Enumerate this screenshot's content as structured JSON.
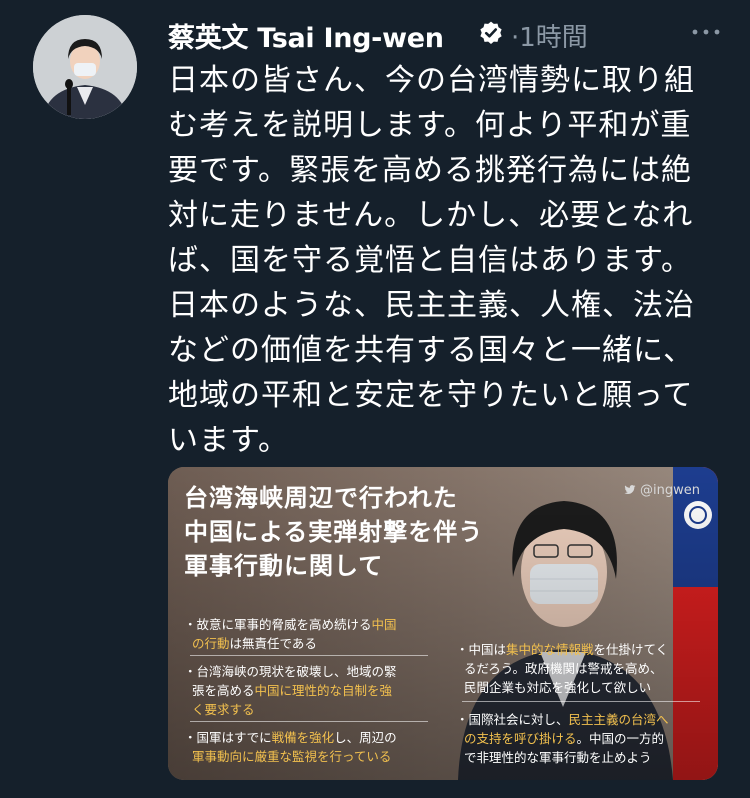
{
  "tweet": {
    "author_name": "蔡英文 Tsai Ing-wen",
    "time": "·1時間",
    "text_lines": [
      "日本の皆さん、今の台湾情勢に取り組",
      "む考えを説明します。何より平和が重",
      "要です。緊張を高める挑発行為には絶",
      "対に走りません。しかし、必要となれ",
      "ば、国を守る覚悟と自信はあります。",
      "日本のような、民主主義、人権、法治",
      "などの価値を共有する国々と一緒に、",
      "地域の平和と安定を守りたいと願って",
      "います。"
    ]
  },
  "icons": {
    "verified": "verified-badge-icon",
    "more": "more-dots-icon",
    "twitter": "twitter-bird-icon"
  },
  "card": {
    "handle": "@ingwen",
    "title_lines": [
      "台湾海峡周辺で行われた",
      "中国による実弾射撃を伴う",
      "軍事行動に関して"
    ],
    "left_bullets": [
      {
        "line1_pre": "・故意に軍事的脅威を高め続ける",
        "line1_hl": "中国",
        "line2_hl": "の行動",
        "line2_post": "は無責任である"
      },
      {
        "line1": "・台湾海峡の現状を破壊し、地域の緊",
        "line2_pre": "張を高める",
        "line2_hl": "中国に理性的な自制を強",
        "line3_hl": "く要求する"
      },
      {
        "line1_pre": "・国軍はすでに",
        "line1_hl": "戦備を強化",
        "line1_post": "し、周辺の",
        "line2_hl": "軍事動向に厳重な監視を行っている"
      }
    ],
    "right_bullets": [
      {
        "line1_pre": "・中国は",
        "line1_hl": "集中的な情報戦",
        "line1_post": "を仕掛けてく",
        "line2": "るだろう。政府機関は警戒を高め、",
        "line3": "民間企業も対応を強化して欲しい"
      },
      {
        "line1_pre": "・国際社会に対し、",
        "line1_hl": "民主主義の台湾へ",
        "line2_hl": "の支持を呼び掛ける",
        "line2_post": "。中国の一方的",
        "line3": "で非理性的な軍事行動を止めよう"
      }
    ]
  },
  "colors": {
    "background": "#15202b",
    "text": "#ffffff",
    "secondary_text": "#8b98a5",
    "highlight": "#f2c04e",
    "flag_red": "#e02020",
    "flag_blue": "#1d3d8f"
  }
}
